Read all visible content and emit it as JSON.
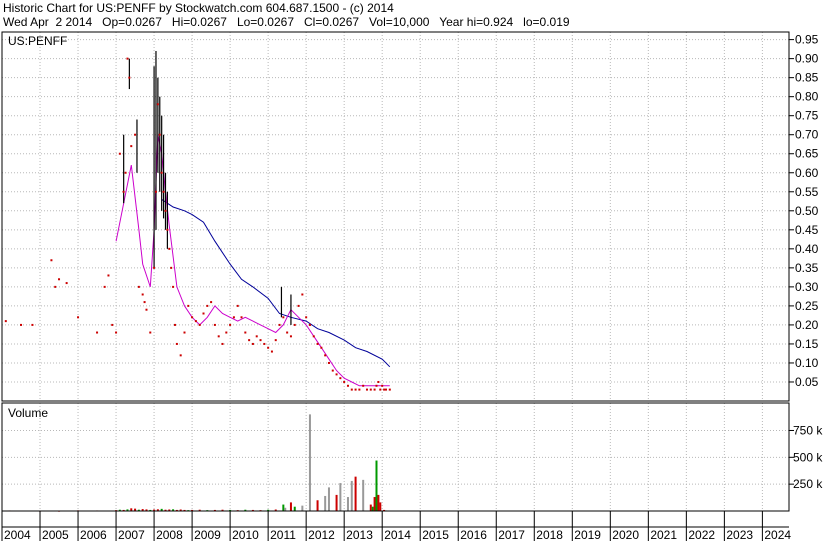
{
  "header": {
    "line1": "Historic Chart for US:PENFF by Stockwatch.com 604.687.1500 - (c) 2014",
    "line2": "Wed Apr  2 2014   Op=0.0267   Hi=0.0267   Lo=0.0267   Cl=0.0267   Vol=10,000   Year hi=0.924   lo=0.019"
  },
  "colors": {
    "price": "#cc0000",
    "range": "#000000",
    "ma_short": "#cc00cc",
    "ma_long": "#000099",
    "vol_up": "#009900",
    "vol_down": "#cc0000",
    "vol_neutral": "#999999"
  },
  "chart_data": [
    {
      "type": "scatter",
      "title": "US:PENFF",
      "ylim": [
        0,
        0.97
      ],
      "yticks": [
        "0.95",
        "0.90",
        "0.85",
        "0.80",
        "0.75",
        "0.70",
        "0.65",
        "0.60",
        "0.55",
        "0.50",
        "0.45",
        "0.40",
        "0.35",
        "0.30",
        "0.25",
        "0.20",
        "0.15",
        "0.10",
        "0.05"
      ],
      "xlim": [
        2004,
        2024.7
      ],
      "xticks": [
        "2004",
        "2005",
        "2006",
        "2007",
        "2008",
        "2009",
        "2010",
        "2011",
        "2012",
        "2013",
        "2014",
        "2015",
        "2016",
        "2017",
        "2018",
        "2019",
        "2020",
        "2021",
        "2022",
        "2023",
        "2024"
      ],
      "grid": true,
      "series": [
        {
          "kind": "close",
          "x": [
            2004.1,
            2004.5,
            2004.8,
            2005.3,
            2005.4,
            2005.5,
            2005.7,
            2006.0,
            2006.5,
            2006.7,
            2006.8,
            2006.9,
            2007.0,
            2007.1,
            2007.2,
            2007.25,
            2007.3,
            2007.35,
            2007.4,
            2007.5,
            2007.6,
            2007.7,
            2007.75,
            2007.8,
            2007.9,
            2008.0,
            2008.05,
            2008.1,
            2008.15,
            2008.2,
            2008.25,
            2008.3,
            2008.35,
            2008.4,
            2008.45,
            2008.5,
            2008.55,
            2008.6,
            2008.7,
            2008.8,
            2008.9,
            2009.0,
            2009.1,
            2009.2,
            2009.3,
            2009.4,
            2009.5,
            2009.6,
            2009.7,
            2009.8,
            2009.9,
            2010.0,
            2010.1,
            2010.2,
            2010.3,
            2010.4,
            2010.5,
            2010.6,
            2010.7,
            2010.8,
            2010.9,
            2011.0,
            2011.1,
            2011.2,
            2011.3,
            2011.4,
            2011.5,
            2011.6,
            2011.7,
            2011.8,
            2011.9,
            2012.0,
            2012.1,
            2012.2,
            2012.3,
            2012.4,
            2012.5,
            2012.6,
            2012.7,
            2012.8,
            2012.9,
            2013.0,
            2013.1,
            2013.2,
            2013.3,
            2013.4,
            2013.5,
            2013.6,
            2013.7,
            2013.8,
            2013.85,
            2013.9,
            2013.95,
            2014.0,
            2014.05,
            2014.1,
            2014.2
          ],
          "y": [
            0.21,
            0.2,
            0.2,
            0.37,
            0.3,
            0.32,
            0.31,
            0.22,
            0.18,
            0.3,
            0.33,
            0.2,
            0.18,
            0.65,
            0.55,
            0.6,
            0.9,
            0.85,
            0.67,
            0.7,
            0.3,
            0.28,
            0.26,
            0.24,
            0.18,
            0.35,
            0.55,
            0.78,
            0.7,
            0.6,
            0.55,
            0.5,
            0.45,
            0.4,
            0.35,
            0.3,
            0.2,
            0.15,
            0.12,
            0.18,
            0.25,
            0.22,
            0.21,
            0.2,
            0.23,
            0.25,
            0.26,
            0.2,
            0.17,
            0.15,
            0.18,
            0.2,
            0.22,
            0.25,
            0.22,
            0.18,
            0.16,
            0.15,
            0.17,
            0.16,
            0.15,
            0.14,
            0.13,
            0.16,
            0.2,
            0.22,
            0.18,
            0.17,
            0.2,
            0.25,
            0.28,
            0.22,
            0.2,
            0.17,
            0.15,
            0.14,
            0.12,
            0.1,
            0.08,
            0.07,
            0.06,
            0.05,
            0.04,
            0.03,
            0.03,
            0.03,
            0.04,
            0.03,
            0.03,
            0.03,
            0.04,
            0.05,
            0.03,
            0.04,
            0.03,
            0.03,
            0.03
          ]
        },
        {
          "kind": "range",
          "x": [
            2007.2,
            2007.35,
            2007.55,
            2008.0,
            2008.05,
            2008.1,
            2008.15,
            2008.2,
            2008.25,
            2008.3,
            2008.35,
            2011.35,
            2011.6
          ],
          "low": [
            0.52,
            0.82,
            0.6,
            0.35,
            0.45,
            0.6,
            0.55,
            0.5,
            0.48,
            0.45,
            0.4,
            0.22,
            0.2
          ],
          "high": [
            0.7,
            0.9,
            0.74,
            0.88,
            0.92,
            0.85,
            0.8,
            0.75,
            0.7,
            0.6,
            0.55,
            0.3,
            0.28
          ]
        },
        {
          "kind": "ma_short",
          "x": [
            2007.0,
            2007.2,
            2007.4,
            2007.6,
            2007.7,
            2007.9,
            2008.0,
            2008.1,
            2008.2,
            2008.3,
            2008.4,
            2008.5,
            2008.6,
            2008.8,
            2009.0,
            2009.2,
            2009.4,
            2009.6,
            2009.8,
            2010.0,
            2010.2,
            2010.4,
            2010.6,
            2010.8,
            2011.0,
            2011.2,
            2011.4,
            2011.6,
            2011.8,
            2012.0,
            2012.2,
            2012.4,
            2012.6,
            2012.8,
            2013.0,
            2013.2,
            2013.4,
            2013.6,
            2013.8,
            2014.0,
            2014.2
          ],
          "y": [
            0.42,
            0.52,
            0.62,
            0.45,
            0.36,
            0.3,
            0.45,
            0.7,
            0.65,
            0.55,
            0.46,
            0.38,
            0.3,
            0.25,
            0.22,
            0.2,
            0.22,
            0.25,
            0.23,
            0.22,
            0.21,
            0.22,
            0.21,
            0.2,
            0.19,
            0.18,
            0.2,
            0.24,
            0.22,
            0.2,
            0.17,
            0.14,
            0.11,
            0.08,
            0.06,
            0.05,
            0.04,
            0.04,
            0.04,
            0.04,
            0.04
          ]
        },
        {
          "kind": "ma_long",
          "x": [
            2008.2,
            2008.5,
            2008.8,
            2009.0,
            2009.3,
            2009.6,
            2010.0,
            2010.3,
            2010.6,
            2011.0,
            2011.3,
            2011.6,
            2012.0,
            2012.3,
            2012.6,
            2013.0,
            2013.3,
            2013.6,
            2014.0,
            2014.2
          ],
          "y": [
            0.53,
            0.51,
            0.5,
            0.49,
            0.47,
            0.42,
            0.36,
            0.32,
            0.3,
            0.27,
            0.23,
            0.22,
            0.21,
            0.19,
            0.18,
            0.16,
            0.14,
            0.13,
            0.11,
            0.09
          ]
        }
      ]
    },
    {
      "type": "bar",
      "title": "Volume",
      "ylim": [
        0,
        950000
      ],
      "yticks": [
        "750 k",
        "500 k",
        "250 k"
      ],
      "xlim": [
        2004,
        2024.7
      ],
      "grid": true,
      "x": [
        2004.2,
        2005.0,
        2005.5,
        2006.0,
        2006.5,
        2007.0,
        2007.1,
        2007.2,
        2007.3,
        2007.4,
        2007.5,
        2007.6,
        2007.7,
        2007.8,
        2007.9,
        2008.0,
        2008.1,
        2008.2,
        2008.3,
        2008.4,
        2008.5,
        2008.6,
        2008.7,
        2008.8,
        2008.9,
        2009.0,
        2009.2,
        2009.4,
        2009.6,
        2009.8,
        2010.0,
        2010.2,
        2010.4,
        2010.6,
        2010.8,
        2011.0,
        2011.2,
        2011.4,
        2011.45,
        2011.6,
        2011.7,
        2011.9,
        2012.1,
        2012.3,
        2012.5,
        2012.6,
        2012.8,
        2012.9,
        2013.1,
        2013.2,
        2013.3,
        2013.5,
        2013.7,
        2013.75,
        2013.8,
        2013.85,
        2013.9,
        2013.95,
        2014.05,
        2014.1
      ],
      "values": [
        5000,
        4000,
        3000,
        6000,
        5000,
        8000,
        12000,
        10000,
        15000,
        25000,
        22000,
        12000,
        18000,
        15000,
        10000,
        14000,
        16000,
        20000,
        12000,
        14000,
        16000,
        10000,
        14000,
        10000,
        8000,
        10000,
        12000,
        8000,
        10000,
        12000,
        10000,
        8000,
        12000,
        10000,
        8000,
        12000,
        14000,
        60000,
        30000,
        80000,
        40000,
        50000,
        900000,
        100000,
        140000,
        220000,
        150000,
        260000,
        130000,
        280000,
        320000,
        290000,
        60000,
        40000,
        130000,
        470000,
        150000,
        80000,
        10000,
        5000
      ],
      "colors": [
        "down",
        "down",
        "down",
        "down",
        "down",
        "down",
        "up",
        "down",
        "up",
        "down",
        "down",
        "up",
        "down",
        "down",
        "up",
        "down",
        "down",
        "up",
        "down",
        "down",
        "up",
        "down",
        "down",
        "down",
        "up",
        "down",
        "down",
        "up",
        "down",
        "down",
        "up",
        "down",
        "up",
        "down",
        "down",
        "up",
        "down",
        "up",
        "neutral",
        "down",
        "up",
        "neutral",
        "neutral",
        "down",
        "neutral",
        "neutral",
        "down",
        "neutral",
        "neutral",
        "neutral",
        "down",
        "neutral",
        "down",
        "up",
        "down",
        "up",
        "down",
        "down",
        "down",
        "up"
      ]
    }
  ]
}
